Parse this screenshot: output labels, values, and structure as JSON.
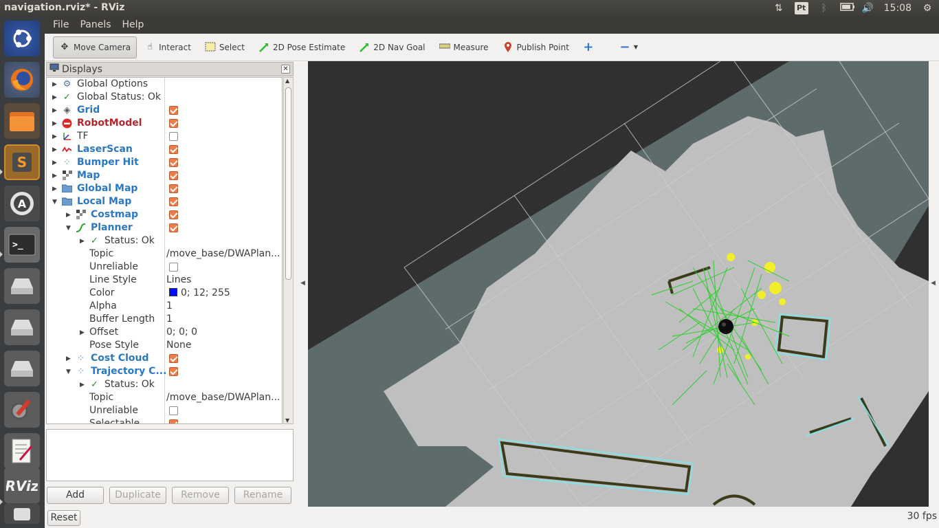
{
  "window": {
    "title": "navigation.rviz* - RViz"
  },
  "tray": {
    "keyboard": "Pt",
    "time": "15:08"
  },
  "menu": {
    "file": "File",
    "panels": "Panels",
    "help": "Help"
  },
  "toolbar": {
    "move_camera": "Move Camera",
    "interact": "Interact",
    "select": "Select",
    "pose_estimate": "2D Pose Estimate",
    "nav_goal": "2D Nav Goal",
    "measure": "Measure",
    "publish_point": "Publish Point"
  },
  "displays": {
    "title": "Displays",
    "rows": [
      {
        "label": "Global Options"
      },
      {
        "label": "Global Status: Ok"
      },
      {
        "label": "Grid",
        "checked": true
      },
      {
        "label": "RobotModel",
        "checked": true
      },
      {
        "label": "TF",
        "checked": false
      },
      {
        "label": "LaserScan",
        "checked": true
      },
      {
        "label": "Bumper Hit",
        "checked": true
      },
      {
        "label": "Map",
        "checked": true
      },
      {
        "label": "Global Map",
        "checked": true
      },
      {
        "label": "Local Map",
        "checked": true
      },
      {
        "label": "Costmap",
        "checked": true
      },
      {
        "label": "Planner",
        "checked": true
      },
      {
        "label": "Status: Ok"
      },
      {
        "label": "Topic",
        "value": "/move_base/DWAPlan..."
      },
      {
        "label": "Unreliable",
        "checked": false
      },
      {
        "label": "Line Style",
        "value": "Lines"
      },
      {
        "label": "Color",
        "value": "0; 12; 255"
      },
      {
        "label": "Alpha",
        "value": "1"
      },
      {
        "label": "Buffer Length",
        "value": "1"
      },
      {
        "label": "Offset",
        "value": "0; 0; 0"
      },
      {
        "label": "Pose Style",
        "value": "None"
      },
      {
        "label": "Cost Cloud",
        "checked": true
      },
      {
        "label": "Trajectory C...",
        "checked": true
      },
      {
        "label": "Status: Ok"
      },
      {
        "label": "Topic",
        "value": "/move_base/DWAPlan..."
      },
      {
        "label": "Unreliable",
        "checked": false
      },
      {
        "label": "Selectable",
        "checked": true
      }
    ],
    "buttons": {
      "add": "Add",
      "duplicate": "Duplicate",
      "remove": "Remove",
      "rename": "Rename"
    }
  },
  "statusbar": {
    "reset": "Reset",
    "fps": "30 fps"
  },
  "colors": {
    "planner_color": "#000cff",
    "checkbox": "#ee7c4a",
    "accent_blue": "#2a78c6"
  }
}
